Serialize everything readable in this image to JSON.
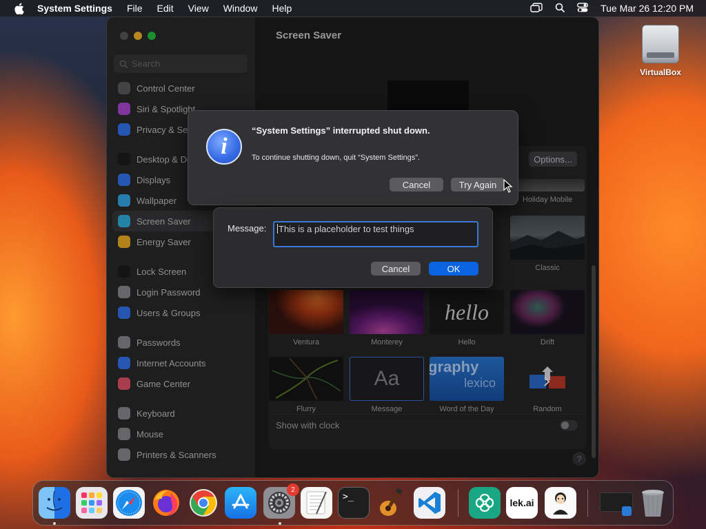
{
  "menubar": {
    "app_name": "System Settings",
    "items": [
      "File",
      "Edit",
      "View",
      "Window",
      "Help"
    ],
    "clock": "Tue Mar 26  12:20 PM"
  },
  "desktop": {
    "icons": [
      {
        "label": "VirtualBox",
        "icon": "external-drive-icon"
      }
    ]
  },
  "settings_window": {
    "search_placeholder": "Search",
    "sidebar_items": [
      {
        "label": "Control Center",
        "icon": "control-center-icon",
        "color": "#5e5e62"
      },
      {
        "label": "Siri & Spotlight",
        "icon": "siri-icon",
        "color": "#b04ad8"
      },
      {
        "label": "Privacy & Security",
        "icon": "hand-icon",
        "color": "#3478f6"
      },
      {
        "label": "Desktop & Dock",
        "icon": "dock-icon",
        "color": "#1c1c1e"
      },
      {
        "label": "Displays",
        "icon": "sun-icon",
        "color": "#3478f6"
      },
      {
        "label": "Wallpaper",
        "icon": "flower-icon",
        "color": "#35aef0"
      },
      {
        "label": "Screen Saver",
        "icon": "screen-saver-icon",
        "color": "#32b4e6"
      },
      {
        "label": "Energy Saver",
        "icon": "bulb-icon",
        "color": "#f5b625"
      },
      {
        "label": "Lock Screen",
        "icon": "lock-icon",
        "color": "#1c1c1e"
      },
      {
        "label": "Login Password",
        "icon": "key-icon",
        "color": "#8e8e93"
      },
      {
        "label": "Users & Groups",
        "icon": "users-icon",
        "color": "#3478f6"
      },
      {
        "label": "Passwords",
        "icon": "key-icon",
        "color": "#8e8e93"
      },
      {
        "label": "Internet Accounts",
        "icon": "at-icon",
        "color": "#3478f6"
      },
      {
        "label": "Game Center",
        "icon": "game-center-icon",
        "color": "#e8556b"
      },
      {
        "label": "Keyboard",
        "icon": "keyboard-icon",
        "color": "#8e8e93"
      },
      {
        "label": "Mouse",
        "icon": "mouse-icon",
        "color": "#8e8e93"
      },
      {
        "label": "Printers & Scanners",
        "icon": "printer-icon",
        "color": "#8e8e93"
      }
    ],
    "active_item": "Screen Saver",
    "content_title": "Screen Saver",
    "options_button": "Options...",
    "savers": [
      {
        "label": "Holiday Mobile"
      },
      {
        "label": "Classic"
      },
      {
        "label": "Ventura"
      },
      {
        "label": "Monterey"
      },
      {
        "label": "Hello"
      },
      {
        "label": "Drift"
      },
      {
        "label": "Flurry"
      },
      {
        "label": "Message"
      },
      {
        "label": "Word of the Day"
      },
      {
        "label": "Random"
      }
    ],
    "thumb_text": {
      "hello": "hello",
      "message": "Aa",
      "word_of_day_1": "graphy",
      "word_of_day_2": "lexico"
    },
    "show_with_clock": "Show with clock",
    "show_with_clock_on": false,
    "help": "?"
  },
  "alert": {
    "icon": "info-icon",
    "icon_glyph": "i",
    "title": "“System Settings” interrupted shut down.",
    "message": "To continue shutting down, quit “System Settings”.",
    "cancel": "Cancel",
    "try_again": "Try Again"
  },
  "message_sheet": {
    "label": "Message:",
    "value": "This is a placeholder to test things",
    "cancel": "Cancel",
    "ok": "OK"
  },
  "dock": {
    "apps": [
      {
        "name": "Finder",
        "icon": "finder-icon",
        "running": true
      },
      {
        "name": "Launchpad",
        "icon": "launchpad-icon",
        "running": false
      },
      {
        "name": "Safari",
        "icon": "safari-icon",
        "running": false
      },
      {
        "name": "Firefox",
        "icon": "firefox-icon",
        "running": false
      },
      {
        "name": "Chrome",
        "icon": "chrome-icon",
        "running": false
      },
      {
        "name": "App Store",
        "icon": "app-store-icon",
        "running": false
      },
      {
        "name": "System Settings",
        "icon": "system-settings-icon",
        "running": true,
        "badge": "2"
      },
      {
        "name": "TextEdit",
        "icon": "textedit-icon",
        "running": false
      },
      {
        "name": "Terminal",
        "icon": "terminal-icon",
        "running": false
      },
      {
        "name": "GarageBand",
        "icon": "garageband-icon",
        "running": false
      },
      {
        "name": "Visual Studio Code",
        "icon": "vscode-icon",
        "running": false
      },
      {
        "name": "ChatGPT",
        "icon": "chatgpt-icon",
        "running": false
      },
      {
        "name": "lek.ai",
        "icon": "lek-ai-icon",
        "running": false,
        "text": "lek.ai"
      },
      {
        "name": "Avatar App",
        "icon": "avatar-app-icon",
        "running": false
      },
      {
        "name": "Recent Window",
        "icon": "minimized-window-icon",
        "running": false
      },
      {
        "name": "Trash",
        "icon": "trash-icon",
        "running": false
      }
    ],
    "terminal_prompt": ">_"
  },
  "colors": {
    "accent": "#0a63e0",
    "focus_ring": "#3a78d6",
    "window_bg": "#1e1e1f",
    "sidebar_bg": "#2a2a2c"
  }
}
